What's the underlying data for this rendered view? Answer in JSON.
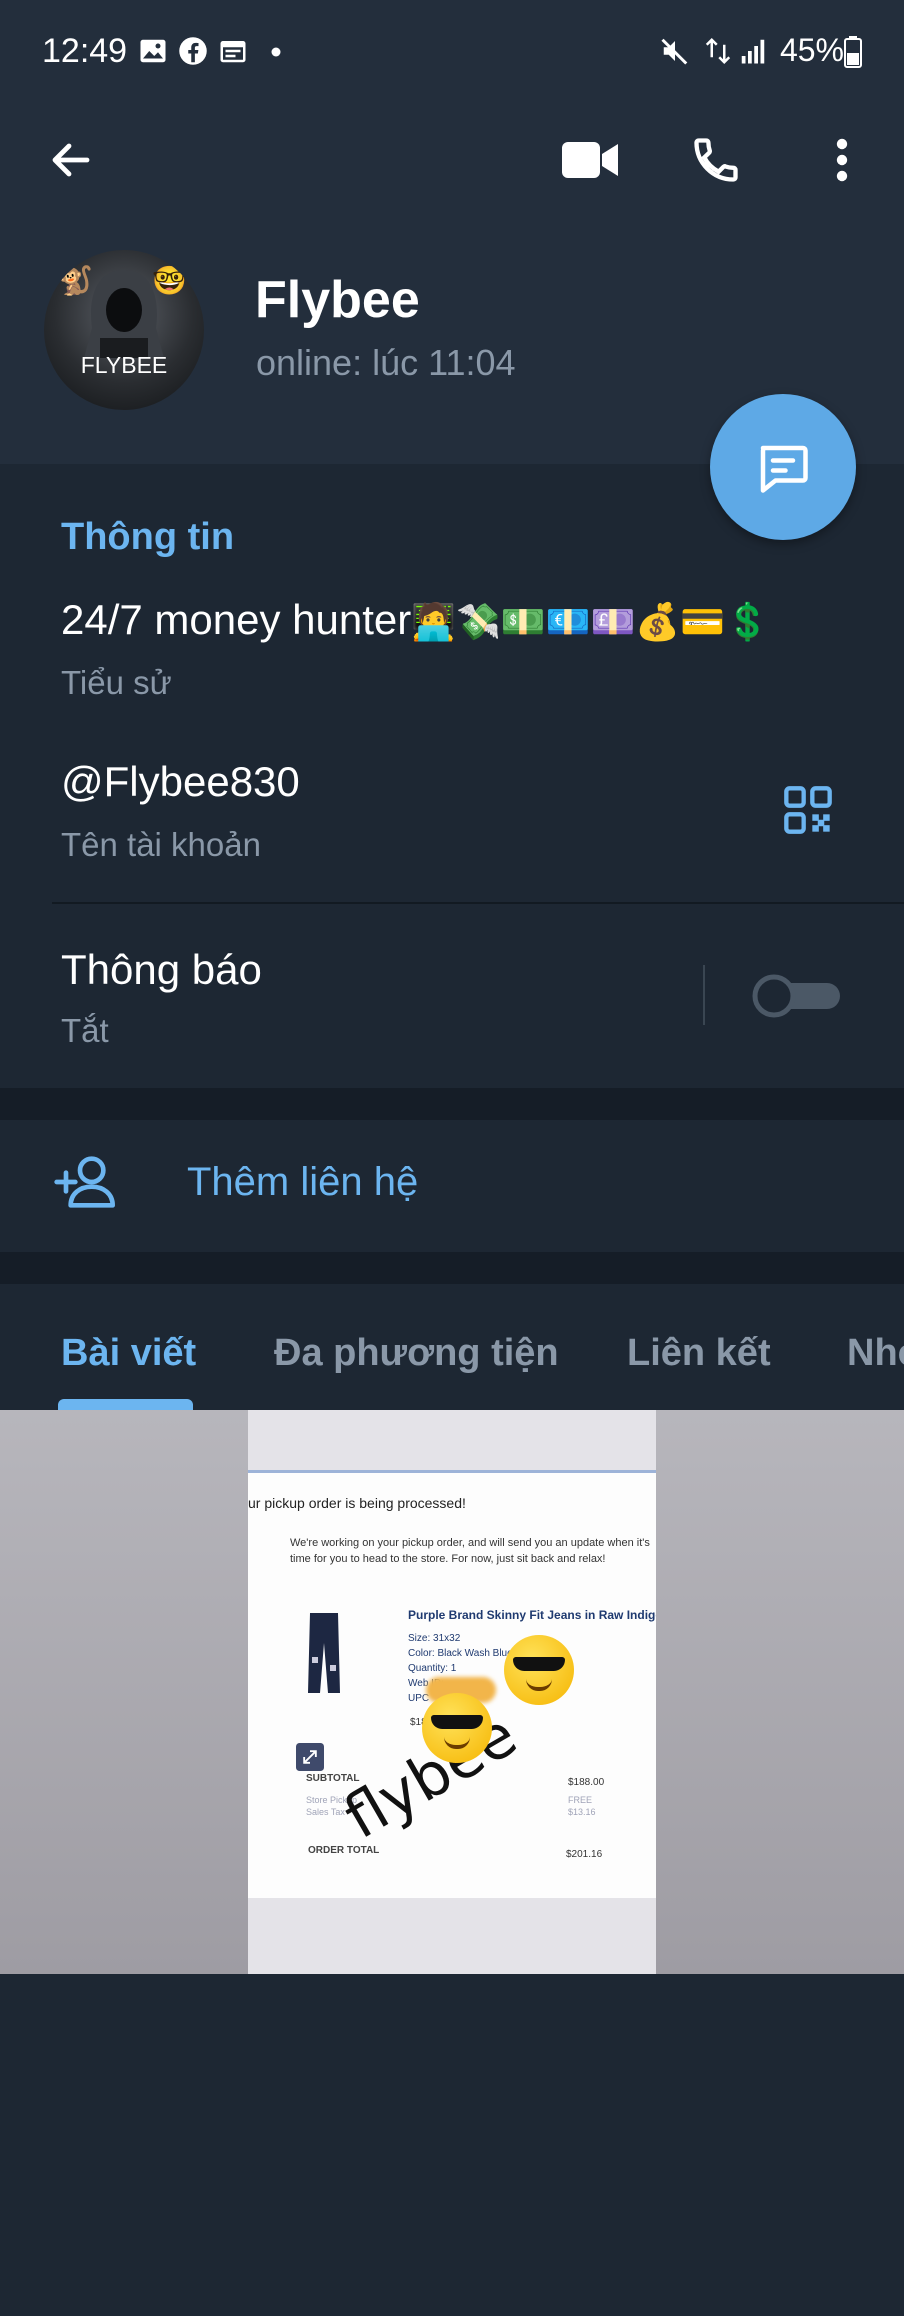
{
  "status_bar": {
    "time": "12:49",
    "battery": "45%",
    "icons": [
      "image-icon",
      "facebook-icon",
      "calendar-icon",
      "dot-icon",
      "mute-icon",
      "data-arrows-icon",
      "signal-icon",
      "battery-icon"
    ]
  },
  "header": {
    "name": "Flybee",
    "status": "online: lúc 11:04",
    "avatar_text": "FLYBEE",
    "actions": [
      "back-arrow-icon",
      "video-call-icon",
      "phone-icon",
      "more-vert-icon"
    ],
    "fab_icon": "message-icon"
  },
  "info": {
    "section_title": "Thông tin",
    "bio": "24/7 money hunter",
    "bio_emoji": "🧑‍💻💸💵💶💷💰💳💲",
    "bio_label": "Tiểu sử",
    "username": "@Flybee830",
    "username_label": "Tên tài khoản",
    "notifications": "Thông báo",
    "notifications_value": "Tắt",
    "notifications_enabled": false
  },
  "add_contact": {
    "label": "Thêm liên hệ"
  },
  "tabs": [
    {
      "label": "Bài viết",
      "active": true
    },
    {
      "label": "Đa phương tiện",
      "active": false
    },
    {
      "label": "Liên kết",
      "active": false
    },
    {
      "label": "Nhó",
      "active": false
    }
  ],
  "media": {
    "receipt": {
      "heading": "ur pickup order is being processed!",
      "body": "We're working on your pickup order, and will send you an update when it's time for you to head to the store. For now, just sit back and relax!",
      "product": "Purple Brand Skinny Fit Jeans in Raw Indigo",
      "size": "Size: 31x32",
      "color": "Color: Black Wash Blue",
      "quantity": "Quantity: 1",
      "web_id": "Web ID:",
      "upc": "UPC",
      "price": "$188.00",
      "subtotal_label": "SUBTOTAL",
      "subtotal": "$188.00",
      "store_pickup": "Store Pickup",
      "sales_tax": "Sales Tax",
      "free": "FREE",
      "tax": "$13.16",
      "order_total_label": "ORDER TOTAL",
      "order_total": "$201.16"
    },
    "watermark": "flybee"
  },
  "colors": {
    "bg": "#1d2733",
    "header_bg": "#232e3c",
    "accent": "#6cb5f0",
    "fab": "#5ea9e6",
    "muted": "#8a98a8"
  }
}
